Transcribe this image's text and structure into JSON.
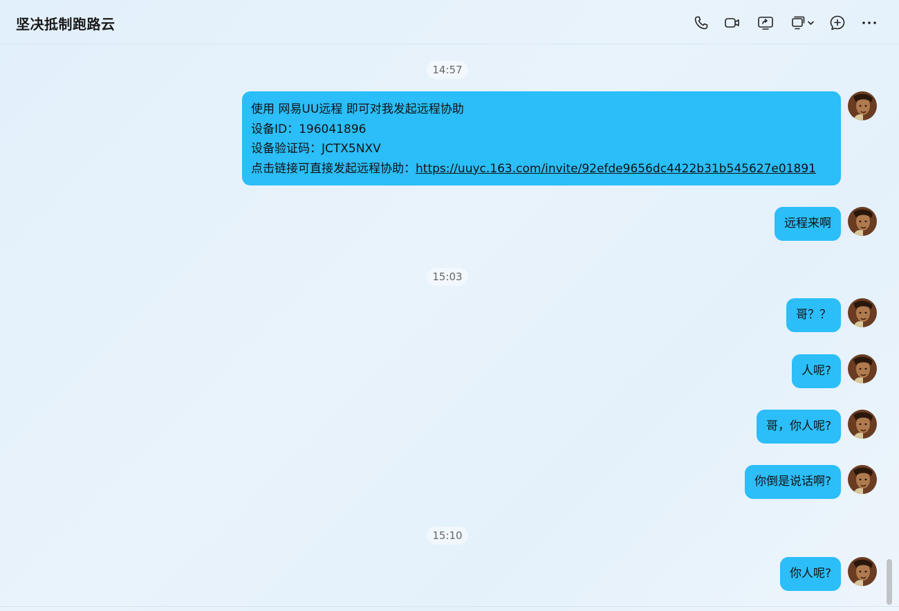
{
  "header": {
    "title": "坚决抵制跑路云",
    "icons": [
      "phone-icon",
      "video-call-icon",
      "screen-share-icon",
      "remote-assist-icon",
      "add-member-icon",
      "more-icon"
    ]
  },
  "timestamps": [
    "14:57",
    "15:03",
    "15:10"
  ],
  "messages": {
    "m1": {
      "line1": "使用 网易UU远程 即可对我发起远程协助",
      "line2": "设备ID：196041896",
      "line3": "设备验证码：JCTX5NXV",
      "line4_prefix": "点击链接可直接发起远程协助：",
      "line4_link": "https://uuyc.163.com/invite/92efde9656dc4422b31b545627e01891"
    },
    "m2": "远程来啊",
    "m3": "哥？？",
    "m4": "人呢?",
    "m5": "哥，你人呢?",
    "m6": "你倒是说话啊?",
    "m7": "你人呢?"
  },
  "colors": {
    "bubble": "#2bbef8",
    "background": "#e4f1fb"
  }
}
